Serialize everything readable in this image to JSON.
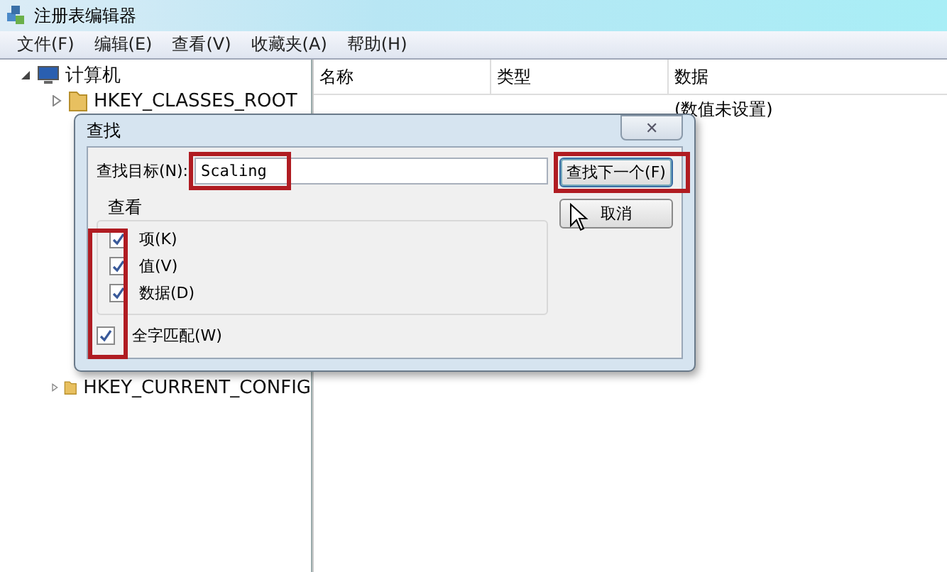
{
  "window": {
    "title": "注册表编辑器"
  },
  "menu": [
    "文件(F)",
    "编辑(E)",
    "查看(V)",
    "收藏夹(A)",
    "帮助(H)"
  ],
  "tree": {
    "label": "计算机",
    "expanded": true,
    "children": [
      {
        "label": "HKEY_CLASSES_ROOT",
        "expanded": false
      },
      {
        "label": "HKEY_CURRENT_CONFIG",
        "expanded": false
      }
    ]
  },
  "list": {
    "columns": [
      "名称",
      "类型",
      "数据"
    ],
    "rows": [
      {
        "column_3": "(数值未设置)"
      }
    ]
  },
  "dialog": {
    "title": "查找",
    "close": "✕",
    "target_label": "查找目标(N):",
    "target_value": "Scaling",
    "buttons": [
      {
        "label": "查找下一个(F)",
        "selected": true
      },
      {
        "label": "取消",
        "selected": false
      }
    ],
    "group_label": "查看",
    "options": [
      {
        "label": "项(K)",
        "checked": true
      },
      {
        "label": "值(V)",
        "checked": true
      },
      {
        "label": "数据(D)",
        "checked": true
      }
    ],
    "whole_word": {
      "label": "全字匹配(W)",
      "checked": true
    }
  }
}
